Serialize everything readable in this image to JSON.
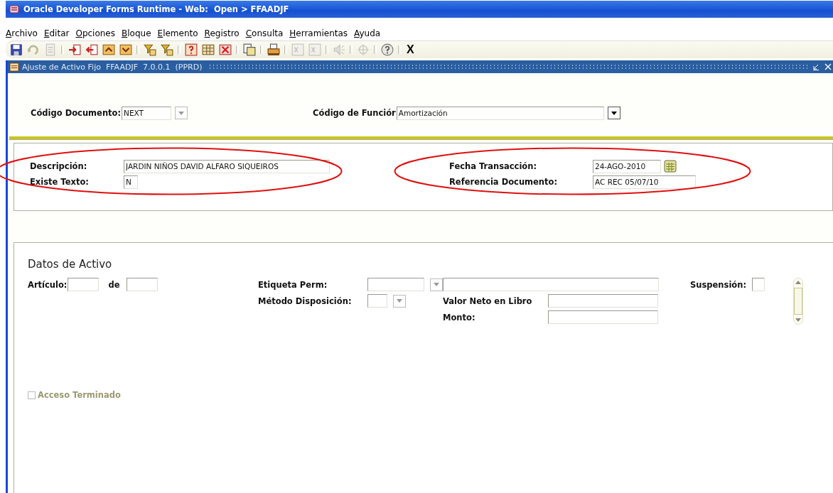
{
  "window": {
    "title": "Oracle Developer Forms Runtime - Web:  Open > FFAADJF"
  },
  "menu": [
    "Archivo",
    "Editar",
    "Opciones",
    "Bloque",
    "Elemento",
    "Registro",
    "Consulta",
    "Herramientas",
    "Ayuda"
  ],
  "toolbar": [
    {
      "kind": "save",
      "disabled": false
    },
    {
      "kind": "undo",
      "disabled": true
    },
    {
      "kind": "page",
      "disabled": true
    },
    {
      "kind": "separator"
    },
    {
      "kind": "insert",
      "disabled": false
    },
    {
      "kind": "remove",
      "disabled": false
    },
    {
      "kind": "block-up",
      "disabled": false
    },
    {
      "kind": "block-down",
      "disabled": false
    },
    {
      "kind": "separator"
    },
    {
      "kind": "query-enter",
      "disabled": false
    },
    {
      "kind": "query-run",
      "disabled": false
    },
    {
      "kind": "separator"
    },
    {
      "kind": "question-box",
      "disabled": false
    },
    {
      "kind": "table",
      "disabled": false
    },
    {
      "kind": "clear",
      "disabled": false
    },
    {
      "kind": "separator"
    },
    {
      "kind": "documents",
      "disabled": false
    },
    {
      "kind": "separator"
    },
    {
      "kind": "printer",
      "disabled": false
    },
    {
      "kind": "separator"
    },
    {
      "kind": "xs",
      "disabled": true
    },
    {
      "kind": "xs",
      "disabled": true
    },
    {
      "kind": "separator"
    },
    {
      "kind": "speaker",
      "disabled": true
    },
    {
      "kind": "separator"
    },
    {
      "kind": "crosshair",
      "disabled": true
    },
    {
      "kind": "separator"
    },
    {
      "kind": "help",
      "disabled": false
    },
    {
      "kind": "separator"
    },
    {
      "kind": "text",
      "label": "X"
    }
  ],
  "form_window": {
    "title": "Ajuste de Activo Fijo  FFAADJF  7.0.0.1  (PPRD)"
  },
  "header": [
    {
      "label": "Código Documento:",
      "value": "NEXT",
      "dropdown_disabled": true
    },
    {
      "label": "Código de Funciór",
      "value": "Amortización",
      "dropdown_disabled": false
    }
  ],
  "details": [
    {
      "circled": true,
      "fields": [
        {
          "label": "Descripción:",
          "value": "JARDIN NIÑOS DAVID ALFARO SIQUEIROS"
        },
        {
          "label": "Existe Texto:",
          "value": "N"
        }
      ]
    },
    {
      "circled": true,
      "fields": [
        {
          "label": "Fecha Transacción:",
          "value": "24-AGO-2010",
          "calendar": true
        },
        {
          "label": "Referencia Documento:",
          "value": "AC REC 05/07/10"
        }
      ]
    }
  ],
  "asset": {
    "title": "Datos de Activo",
    "article_label": "Artículo:",
    "of_label": "de",
    "tag_label": "Etiqueta Perm:",
    "disposal_label": "Método Disposición:",
    "book_value_label": "Valor Neto en Libro",
    "amount_label": "Monto:",
    "suspension_label": "Suspensión:",
    "terminated": {
      "label": "Acceso Terminado",
      "checked": false,
      "disabled": true
    }
  }
}
